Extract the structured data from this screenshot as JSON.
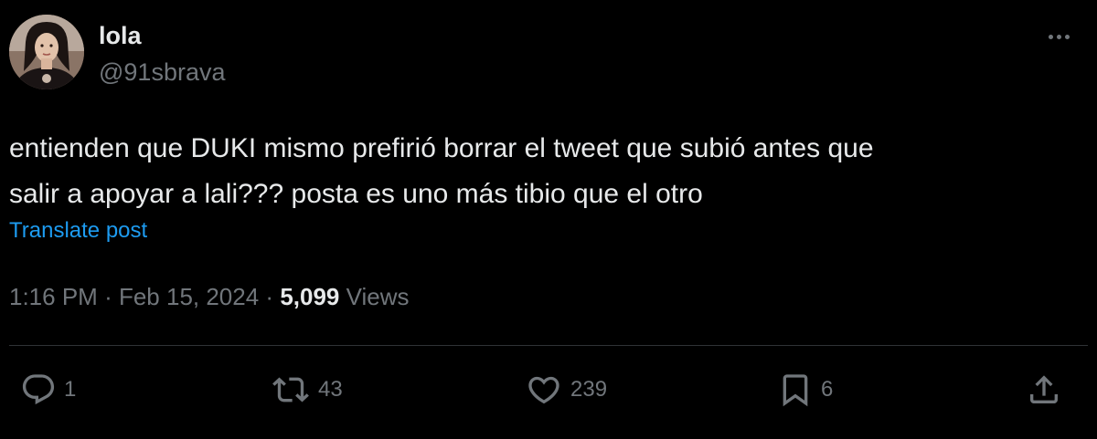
{
  "author": {
    "display_name": "lola",
    "handle": "@91sbrava"
  },
  "tweet": {
    "text_line_1": "entienden que DUKI mismo prefirió borrar el tweet que subió antes que",
    "text_line_2": "salir a apoyar a lali??? posta es uno más tibio que el otro",
    "translate_label": "Translate post"
  },
  "meta": {
    "time": "1:16 PM",
    "separator": "·",
    "date": "Feb 15, 2024",
    "views_count": "5,099",
    "views_label": "Views"
  },
  "actions": {
    "replies": "1",
    "reposts": "43",
    "likes": "239",
    "bookmarks": "6"
  },
  "colors": {
    "background": "#000000",
    "primary_text": "#e7e9ea",
    "secondary_text": "#71767b",
    "link": "#1d9bf0",
    "divider": "#2f3336"
  },
  "icons": {
    "more": "more-dots-icon",
    "reply": "reply-bubble-icon",
    "repost": "repost-arrows-icon",
    "like": "heart-icon",
    "bookmark": "bookmark-icon",
    "share": "share-upload-icon"
  }
}
